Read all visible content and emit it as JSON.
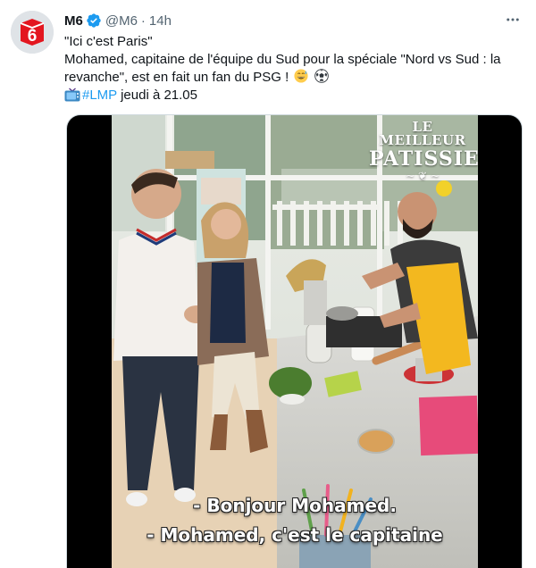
{
  "tweet": {
    "author_name": "M6",
    "handle": "@M6",
    "separator": "·",
    "time": "14h",
    "avatar_logo_text": "6",
    "line1": "\"Ici c'est Paris\"",
    "line2": "Mohamed, capitaine de l'équipe du Sud pour la spéciale \"Nord vs Sud : la revanche\", est en fait un fan du PSG !",
    "hashtag": "#LMP",
    "schedule": " jeudi à 21.05"
  },
  "media": {
    "show_logo_line1": "LE MEILLEUR",
    "show_logo_line2": "PATISSIER",
    "subtitle_line1": "- Bonjour Mohamed.",
    "subtitle_line2": "- Mohamed, c'est le capitaine"
  },
  "icons": {
    "verified": "verified-badge-icon",
    "more": "more-icon",
    "emoji1": "grinning-sweat-emoji",
    "emoji2": "soccer-ball-emoji",
    "tv": "television-emoji"
  },
  "colors": {
    "brand_red": "#e3161f",
    "verified_blue": "#1d9bf0",
    "hashtag_blue": "#1d9bf0",
    "muted": "#536471",
    "apron_yellow": "#f3b81f"
  }
}
